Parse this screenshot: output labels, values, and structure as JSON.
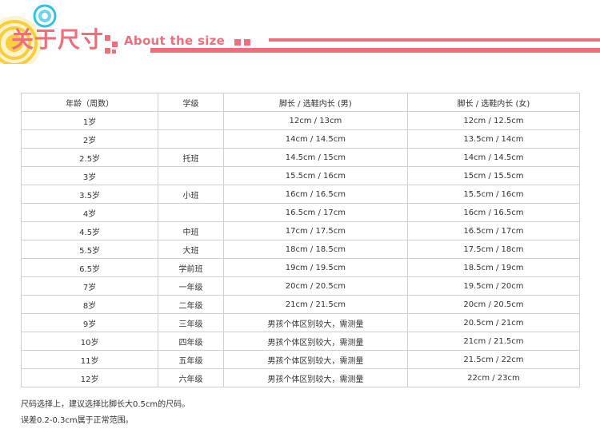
{
  "header": {
    "title_cn": "关于尺寸",
    "title_en": "About the size"
  },
  "table": {
    "headers": [
      "年龄（周数）",
      "学级",
      "脚长 / 选鞋内长 (男)",
      "脚长 / 选鞋内长 (女)"
    ],
    "rows": [
      [
        "1岁",
        "",
        "12cm / 13cm",
        "12cm / 12.5cm"
      ],
      [
        "2岁",
        "",
        "14cm / 14.5cm",
        "13.5cm / 14cm"
      ],
      [
        "2.5岁",
        "托班",
        "14.5cm / 15cm",
        "14cm / 14.5cm"
      ],
      [
        "3岁",
        "",
        "15.5cm / 16cm",
        "15cm / 15.5cm"
      ],
      [
        "3.5岁",
        "小班",
        "16cm / 16.5cm",
        "15.5cm / 16cm"
      ],
      [
        "4岁",
        "",
        "16.5cm / 17cm",
        "16cm / 16.5cm"
      ],
      [
        "4.5岁",
        "中班",
        "17cm / 17.5cm",
        "16.5cm / 17cm"
      ],
      [
        "5.5岁",
        "大班",
        "18cm / 18.5cm",
        "17.5cm / 18cm"
      ],
      [
        "6.5岁",
        "学前班",
        "19cm / 19.5cm",
        "18.5cm / 19cm"
      ],
      [
        "7岁",
        "一年级",
        "20cm / 20.5cm",
        "19.5cm / 20cm"
      ],
      [
        "8岁",
        "二年级",
        "21cm / 21.5cm",
        "20cm / 20.5cm"
      ],
      [
        "9岁",
        "三年级",
        "男孩个体区别较大，需测量",
        "20.5cm / 21cm"
      ],
      [
        "10岁",
        "四年级",
        "男孩个体区别较大，需测量",
        "21cm / 21.5cm"
      ],
      [
        "11岁",
        "五年级",
        "男孩个体区别较大，需测量",
        "21.5cm / 22cm"
      ],
      [
        "12岁",
        "六年级",
        "男孩个体区别较大，需测量",
        "22cm / 23cm"
      ]
    ]
  },
  "notes": {
    "line1": "尺码选择上，建议选择比脚长大0.5cm的尺码。",
    "line2": "误差0.2-0.3cm属于正常范围。"
  },
  "colors": {
    "accent": "#ef6e7e",
    "circle_yellow": "#f7cf3c",
    "circle_cyan": "#2fc3e0",
    "border": "#cfcfcf"
  }
}
